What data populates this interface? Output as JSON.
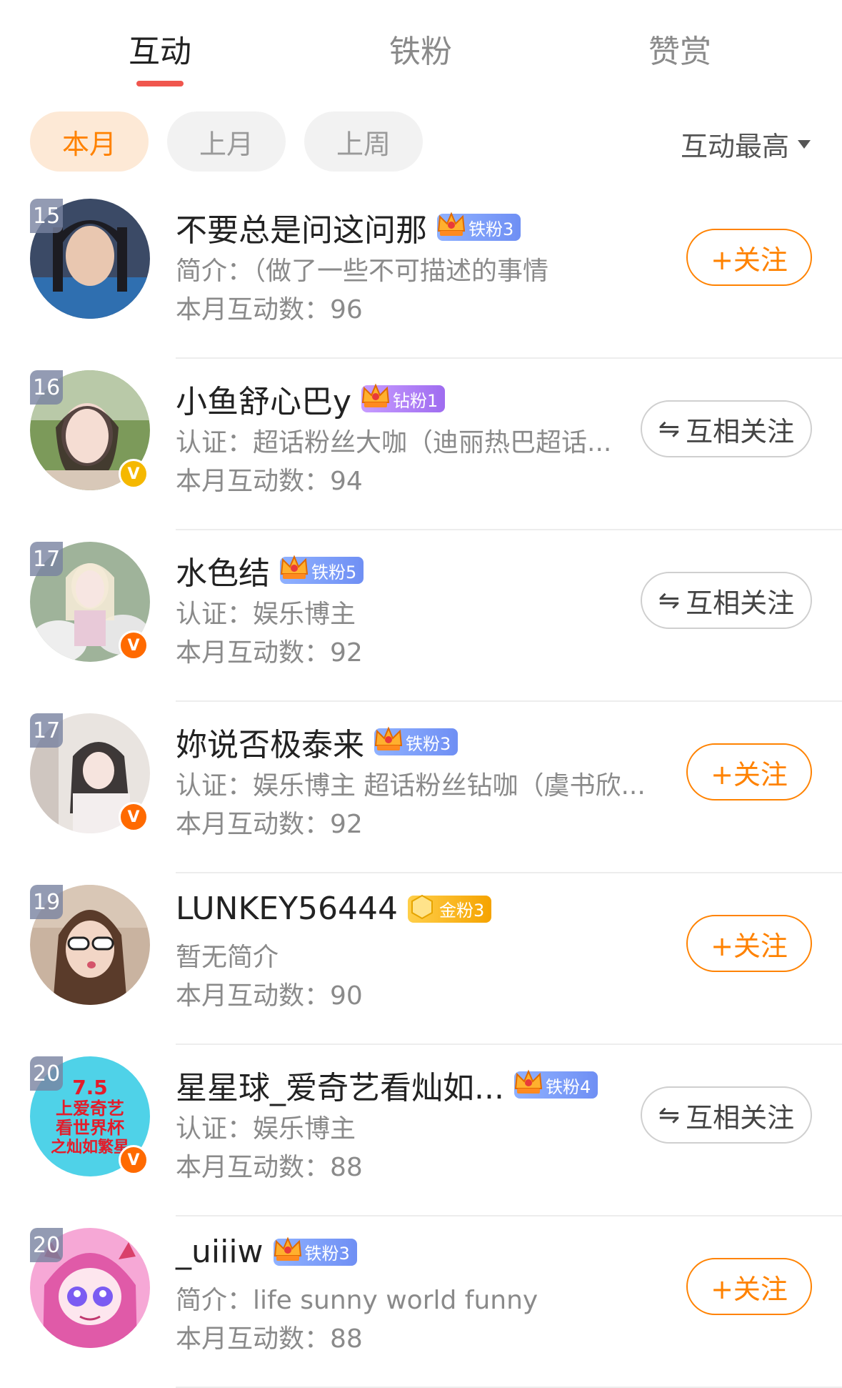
{
  "tabs": [
    {
      "label": "互动",
      "active": true
    },
    {
      "label": "铁粉",
      "active": false
    },
    {
      "label": "赞赏",
      "active": false
    }
  ],
  "filters": [
    {
      "label": "本月",
      "active": true
    },
    {
      "label": "上月",
      "active": false
    },
    {
      "label": "上周",
      "active": false
    }
  ],
  "sort": {
    "label": "互动最高",
    "icon": "caret-down-icon"
  },
  "colors": {
    "accent": "#ff8200",
    "tab_underline": "#f0564e",
    "iron": "#7b9cf7",
    "diamond": "#b27cf6",
    "gold": "#f8b800"
  },
  "follow_label": "+关注",
  "mutual_label": "互相关注",
  "rows": [
    {
      "rank": "15",
      "name": "不要总是问这问那",
      "fan_badge": "铁粉3",
      "fan_type": "iron",
      "desc": "简介：（做了一些不可描述的事情",
      "count": "本月互动数：96",
      "verified": "",
      "button": "follow"
    },
    {
      "rank": "16",
      "name": "小鱼舒心巴y",
      "fan_badge": "钻粉1",
      "fan_type": "diamond",
      "desc": "认证：超话粉丝大咖（迪丽热巴超话...",
      "count": "本月互动数：94",
      "verified": "gold",
      "button": "mutual"
    },
    {
      "rank": "17",
      "name": "水色结",
      "fan_badge": "铁粉5",
      "fan_type": "iron",
      "desc": "认证：娱乐博主",
      "count": "本月互动数：92",
      "verified": "orange",
      "button": "mutual"
    },
    {
      "rank": "17",
      "name": "妳说否极泰来",
      "fan_badge": "铁粉3",
      "fan_type": "iron",
      "desc": "认证：娱乐博主 超话粉丝钻咖（虞书欣...",
      "count": "本月互动数：92",
      "verified": "orange",
      "button": "follow"
    },
    {
      "rank": "19",
      "name": "LUNKEY56444",
      "fan_badge": "金粉3",
      "fan_type": "gold",
      "desc": "暂无简介",
      "count": "本月互动数：90",
      "verified": "",
      "button": "follow"
    },
    {
      "rank": "20",
      "name": "星星球_爱奇艺看灿如...",
      "fan_badge": "铁粉4",
      "fan_type": "iron",
      "desc": "认证：娱乐博主",
      "count": "本月互动数：88",
      "verified": "orange",
      "button": "mutual",
      "avatar_text": [
        "7.5",
        "上爱奇艺",
        "看世界杯",
        "之灿如繁星"
      ]
    },
    {
      "rank": "20",
      "name": "_uiiiw",
      "fan_badge": "铁粉3",
      "fan_type": "iron",
      "desc": "简介：life sunny world funny",
      "count": "本月互动数：88",
      "verified": "",
      "button": "follow"
    }
  ]
}
